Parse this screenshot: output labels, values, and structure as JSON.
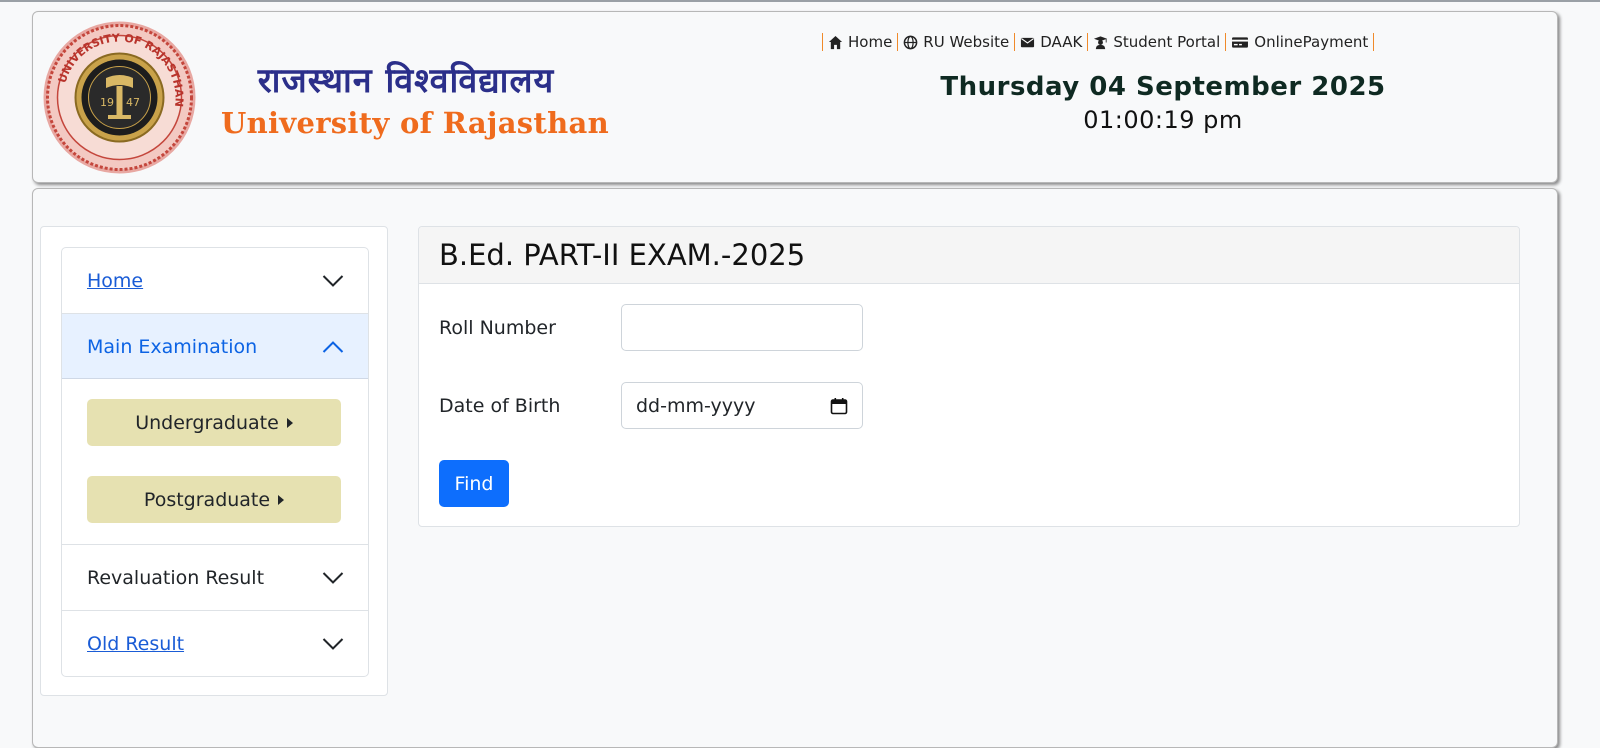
{
  "header": {
    "title_hindi": "राजस्थान विश्वविद्यालय",
    "title_english": "University of Rajasthan",
    "seal": {
      "ring_text": "UNIVERSITY OF RAJASTHAN",
      "year_left": "19",
      "year_right": "47"
    },
    "nav": [
      {
        "label": "Home",
        "icon": "home-icon"
      },
      {
        "label": "RU Website",
        "icon": "globe-icon"
      },
      {
        "label": "DAAK",
        "icon": "envelope-icon"
      },
      {
        "label": "Student Portal",
        "icon": "graduate-icon"
      },
      {
        "label": "OnlinePayment",
        "icon": "credit-card-icon"
      }
    ],
    "date": "Thursday 04 September 2025",
    "time": "01:00:19 pm"
  },
  "sidebar": {
    "items": [
      {
        "label": "Home",
        "expanded": false
      },
      {
        "label": "Main Examination",
        "expanded": true,
        "sub_items": [
          {
            "label": "Undergraduate"
          },
          {
            "label": "Postgraduate"
          }
        ]
      },
      {
        "label": "Revaluation Result",
        "expanded": false
      },
      {
        "label": "Old Result",
        "expanded": false
      }
    ]
  },
  "exam_form": {
    "title": "B.Ed. PART-II EXAM.-2025",
    "roll_label": "Roll Number",
    "roll_value": "",
    "dob_label": "Date of Birth",
    "dob_placeholder": "dd-mm-yyyy",
    "submit_label": "Find"
  },
  "colors": {
    "primary": "#0d6efd",
    "accordion_active_bg": "#e7f1ff",
    "sub_button_bg": "#e6e1b1",
    "title_hindi": "#2b2f8a",
    "title_english": "#ef6b1d",
    "nav_separator": "#f08a2a"
  }
}
